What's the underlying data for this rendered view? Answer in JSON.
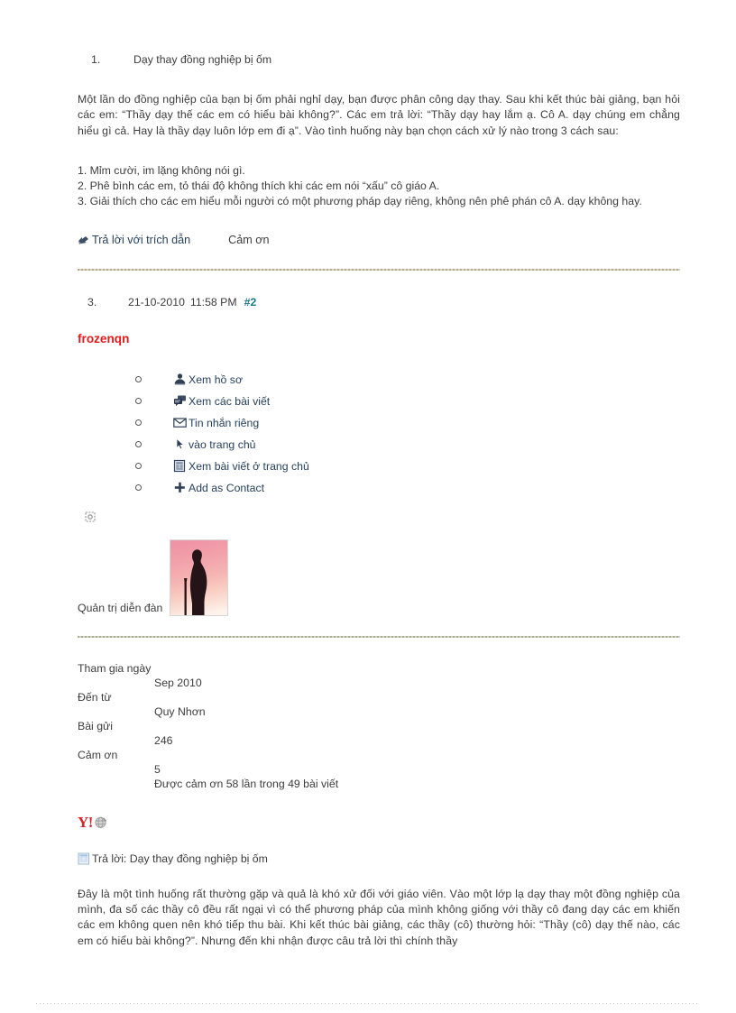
{
  "thread": {
    "item_number": "1.",
    "title": "Dạy thay đồng nghiệp bị ốm",
    "intro": "Một lần do đồng nghiệp của bạn bị ốm phải nghỉ dạy, bạn được phân công dạy thay. Sau khi kết thúc bài giảng, bạn hỏi các em: “Thầy dạy thế các em có hiểu bài không?”. Các em trả lời: “Thầy dạy hay lắm ạ. Cô A. dạy chúng em chẳng hiểu gì cả. Hay là thầy dạy luôn lớp em đi ạ”. Vào tình huống này bạn chọn cách xử lý nào trong 3 cách sau:",
    "options": [
      "1. Mỉm cười, im lặng không nói gì.",
      "2. Phê bình các em, tỏ thái độ không thích khi các em nói “xấu” cô giáo A.",
      "3. Giải thích cho các em hiểu mỗi người có một phương pháp dạy riêng, không nên phê phán cô A. dạy không hay."
    ]
  },
  "actions": {
    "quote_reply_label": "Trả lời với trích dẫn",
    "quote_icon": "quote-icon",
    "thanks_label": "Cảm ơn"
  },
  "post": {
    "number": "3.",
    "date": "21-10-2010",
    "time": "11:58 PM",
    "anchor": "#2",
    "username": "frozenqn",
    "username_color": "#e8191c",
    "anchor_color": "#1a7a8c",
    "rank": "Quản trị diễn đàn",
    "status_icon": "status-offline-icon",
    "avatar_alt": "avatar-silhouette"
  },
  "user_menu": [
    {
      "icon": "profile-person-icon",
      "label": "Xem hồ sơ"
    },
    {
      "icon": "posts-comments-icon",
      "label": "Xem các bài viết"
    },
    {
      "icon": "envelope-icon",
      "label": "Tin nhắn riêng"
    },
    {
      "icon": "cursor-arrow-icon",
      "label": "vào trang chủ"
    },
    {
      "icon": "homepage-posts-icon",
      "label": "Xem bài viết ở trang chủ"
    },
    {
      "icon": "plus-icon",
      "label": "Add as Contact"
    }
  ],
  "stats": [
    {
      "label": "Tham gia ngày",
      "value": "Sep 2010"
    },
    {
      "label": "Đến từ",
      "value": "Quy Nhơn"
    },
    {
      "label": "Bài gửi",
      "value": "246"
    },
    {
      "label": "Cảm ơn",
      "value": "5"
    }
  ],
  "stats_footnote": "Được cảm ơn 58 lần trong 49 bài viết",
  "messenger": {
    "yahoo_logo": "Y!",
    "globe_icon": "yahoo-status-globe-icon",
    "logo_color": "#d9222a"
  },
  "reply": {
    "icon": "post-document-icon",
    "title": "Trả lời: Dạy thay đồng nghiệp bị ốm",
    "body": "Đây là một tình huống rất thường gặp và quả là khó xử đối với giáo viên. Vào một lớp lạ dạy thay một đồng nghiệp của mình, đa số các thầy cô đều rất ngại vì có thể phương pháp của mình không giống với thầy cô đang dạy các em khiến các em không quen nên khó tiếp thu bài. Khi kết thúc bài giảng, các thầy (cô) thường hỏi: “Thầy (cô) dạy thế nào, các em có hiểu bài không?”. Nhưng đến khi nhận được câu trả lời thì chính thầy"
  },
  "separators": {
    "top_color": "#b9a98c",
    "mid_color": "#a9ad93",
    "bottom_color": "#c9c5bb"
  }
}
